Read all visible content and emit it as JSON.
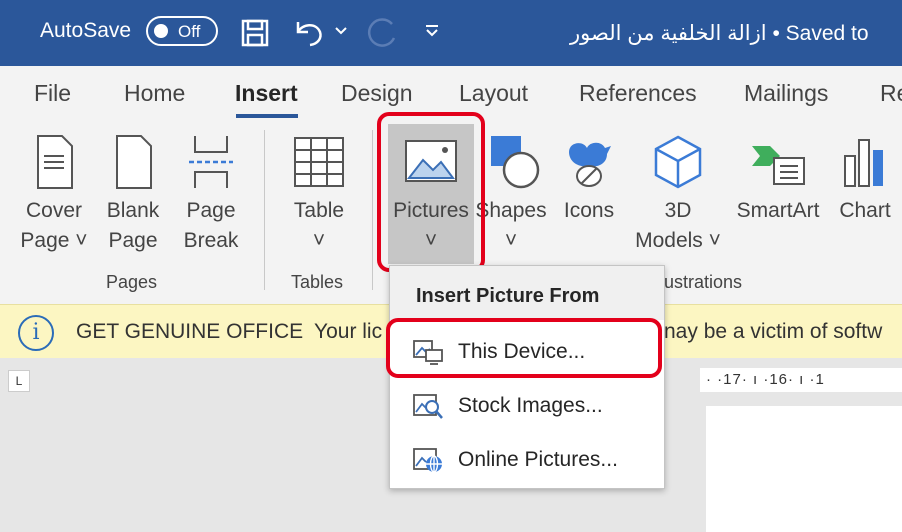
{
  "titlebar": {
    "autosave_label": "AutoSave",
    "toggle_state": "Off",
    "document_title": "ازالة الخلفية من الصور • Saved to"
  },
  "tabs": [
    "File",
    "Home",
    "Insert",
    "Design",
    "Layout",
    "References",
    "Mailings",
    "Re"
  ],
  "active_tab": "Insert",
  "ribbon": {
    "pages": {
      "cover_line1": "Cover",
      "cover_line2": "Page ˅",
      "blank_line1": "Blank",
      "blank_line2": "Page",
      "break_line1": "Page",
      "break_line2": "Break",
      "group_label": "Pages"
    },
    "tables": {
      "table_label": "Table",
      "table_arrow": "˅",
      "group_label": "Tables"
    },
    "illustrations": {
      "pictures_label": "Pictures",
      "pictures_arrow": "˅",
      "shapes_label": "Shapes",
      "shapes_arrow": "˅",
      "icons_label": "Icons",
      "models_line1": "3D",
      "models_line2": "Models ˅",
      "smartart_label": "SmartArt",
      "chart_label": "Chart",
      "group_label_partial": "ustrations"
    }
  },
  "notice": {
    "title": "GET GENUINE OFFICE",
    "text_start": "Your lic",
    "text_end": "nay be a victim of softw"
  },
  "ruler": {
    "corner": "L",
    "marks": "· ·17· ı ·16· ı ·1"
  },
  "dropdown": {
    "header": "Insert Picture From",
    "items": [
      "This Device...",
      "Stock Images...",
      "Online Pictures..."
    ]
  },
  "colors": {
    "titlebar": "#2b579a",
    "highlight": "#e3001b",
    "notice_bg": "#fcf6c2"
  }
}
